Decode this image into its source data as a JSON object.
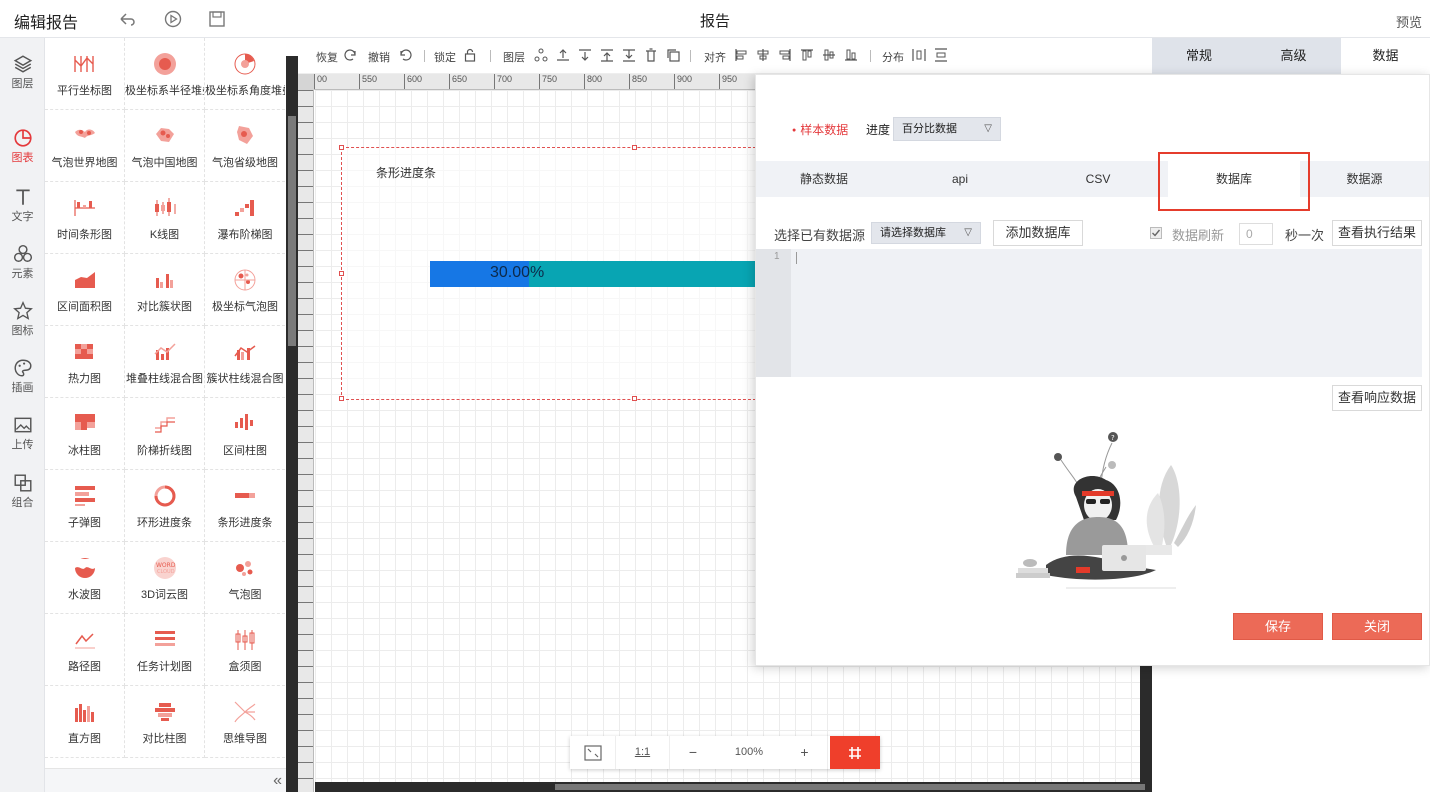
{
  "topbar": {
    "title": "编辑报告",
    "center_title": "报告",
    "preview": "预览"
  },
  "rail": [
    {
      "label": "图层",
      "icon": "layers-icon"
    },
    {
      "label": "图表",
      "icon": "pie-chart-icon",
      "active": true
    },
    {
      "label": "文字",
      "icon": "text-icon"
    },
    {
      "label": "元素",
      "icon": "elements-icon"
    },
    {
      "label": "图标",
      "icon": "star-icon"
    },
    {
      "label": "插画",
      "icon": "palette-icon"
    },
    {
      "label": "上传",
      "icon": "upload-image-icon"
    },
    {
      "label": "组合",
      "icon": "group-icon"
    }
  ],
  "palette": [
    "平行坐标图",
    "极坐标系半径堆叠",
    "极坐标系角度堆叠",
    "气泡世界地图",
    "气泡中国地图",
    "气泡省级地图",
    "时间条形图",
    "K线图",
    "瀑布阶梯图",
    "区间面积图",
    "对比簇状图",
    "极坐标气泡图",
    "热力图",
    "堆叠柱线混合图",
    "簇状柱线混合图",
    "冰柱图",
    "阶梯折线图",
    "区间柱图",
    "子弹图",
    "环形进度条",
    "条形进度条",
    "水波图",
    "3D词云图",
    "气泡图",
    "路径图",
    "任务计划图",
    "盒须图",
    "直方图",
    "对比柱图",
    "思维导图"
  ],
  "toolbar": {
    "redo": "恢复",
    "undo": "撤销",
    "lock": "锁定",
    "layer": "图层",
    "align": "对齐",
    "distribute": "分布"
  },
  "ruler_h": [
    "00",
    "550",
    "600",
    "650",
    "700",
    "750",
    "800",
    "850",
    "900",
    "950"
  ],
  "widget": {
    "title": "条形进度条",
    "progress_text": "30.00%",
    "progress_value": 0.3
  },
  "zoombar": {
    "one_to_one": "1:1",
    "minus": "−",
    "zoom": "100%",
    "plus": "+"
  },
  "righttabs": [
    "常规",
    "高级",
    "数据"
  ],
  "modal": {
    "sample_data": "样本数据",
    "progress_label": "进度",
    "progress_select": "百分比数据",
    "subtabs": [
      "静态数据",
      "api",
      "CSV",
      "数据库",
      "数据源"
    ],
    "active_subtab": "数据库",
    "choose_source": "选择已有数据源",
    "db_select_placeholder": "请选择数据库",
    "add_db": "添加数据库",
    "refresh_label": "数据刷新",
    "refresh_value": "0",
    "per_second": "秒一次",
    "view_exec": "查看执行结果",
    "line_no": "1",
    "view_response": "查看响应数据",
    "save": "保存",
    "close": "关闭"
  },
  "colors": {
    "accent_red": "#e4393c",
    "bar_fill": "#1677e5",
    "bar_track": "#08a5b3",
    "button_red": "#ec6a57"
  }
}
